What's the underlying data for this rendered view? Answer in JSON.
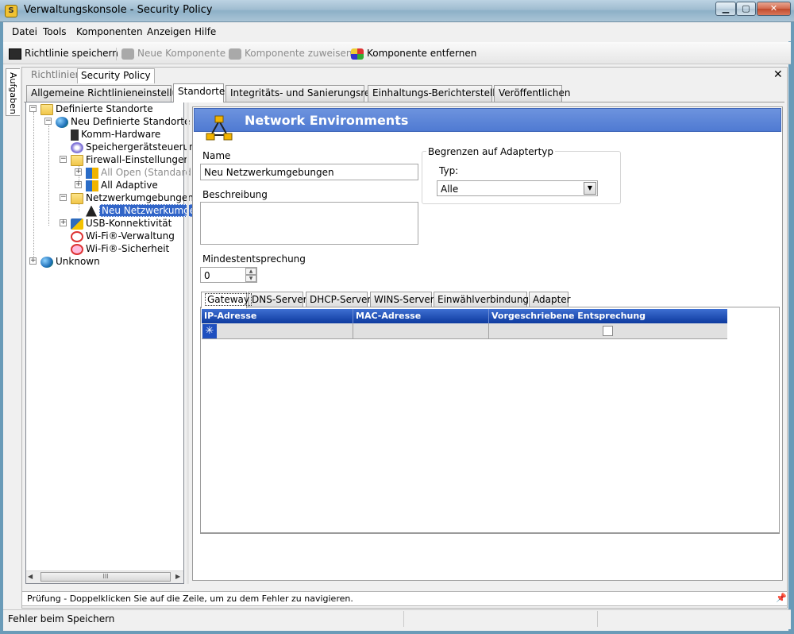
{
  "window": {
    "title": "Verwaltungskonsole - Security Policy",
    "app_icon_glyph": "S"
  },
  "menu": [
    "Datei",
    "Tools",
    "Komponenten",
    "Anzeigen",
    "Hilfe"
  ],
  "toolbar": {
    "save": "Richtlinie speichern",
    "new_component": "Neue Komponente",
    "assign_component": "Komponente zuweisen",
    "remove_component": "Komponente entfernen"
  },
  "side_tab": "Aufgaben",
  "doc_tabs": {
    "policies": "Richtlinien",
    "current": "Security Policy"
  },
  "tabs": [
    "Allgemeine Richtlinieneinstellungen",
    "Standorte",
    "Integritäts- und Sanierungsregeln",
    "Einhaltungs-Berichterstellung",
    "Veröffentlichen"
  ],
  "tree": {
    "root": "Definierte Standorte",
    "location": "Neu Definierte Standorte",
    "comm_hardware": "Komm-Hardware",
    "storage": "Speichergerätsteuerun",
    "firewall": "Firewall-Einstellungen",
    "all_open": "All Open (Standard)",
    "all_adaptive": "All Adaptive",
    "network_envs": "Netzwerkumgebungen",
    "new_network_env": "Neu Netzwerkumge",
    "usb": "USB-Konnektivität",
    "wifi_admin": "Wi-Fi®-Verwaltung",
    "wifi_security": "Wi-Fi®-Sicherheit",
    "unknown": "Unknown",
    "hscroll_thumb": "III"
  },
  "panel": {
    "title": "Network Environments",
    "name_label": "Name",
    "name_value": "Neu Netzwerkumgebungen",
    "description_label": "Beschreibung",
    "description_value": "",
    "adapter_group": "Begrenzen auf Adaptertyp",
    "type_label": "Typ:",
    "type_value": "Alle",
    "min_match_label": "Mindestentsprechung",
    "min_match_value": "0"
  },
  "subtabs": [
    "Gateway",
    "DNS-Server",
    "DHCP-Server",
    "WINS-Server",
    "Einwählverbindungen",
    "Adapter"
  ],
  "grid": {
    "columns": [
      "IP-Adresse",
      "MAC-Adresse",
      "Vorgeschriebene Entsprechung"
    ],
    "new_row_marker": "✳"
  },
  "error_bar": "Prüfung - Doppelklicken Sie auf die Zeile, um zu dem Fehler zu navigieren.",
  "status": "Fehler beim Speichern",
  "colors": {
    "header_blue": "#5a83d6",
    "grid_header": "#1f4fb5",
    "selection": "#1e4fbf"
  }
}
